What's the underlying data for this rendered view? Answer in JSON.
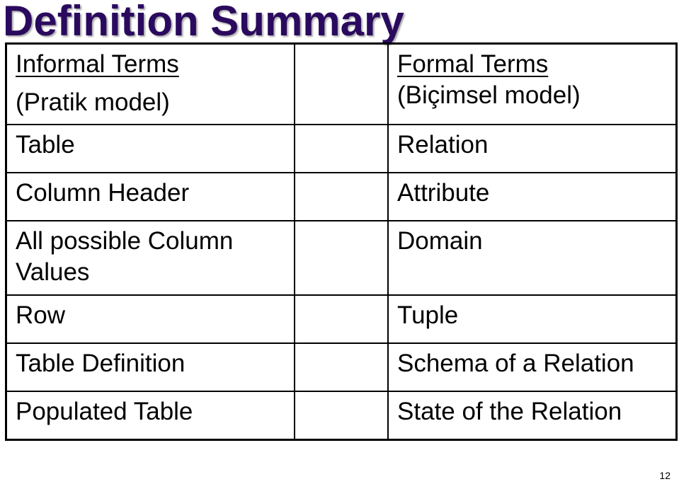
{
  "slide": {
    "title": "Definition Summary",
    "page_number": "12",
    "title_color": "#2a0a5e"
  },
  "table": {
    "header": {
      "informal_label": "Informal Terms",
      "informal_sub": "(Pratik model)",
      "middle": "",
      "formal_label": "Formal Terms",
      "formal_sub": "(Biçimsel model)"
    },
    "rows": [
      {
        "informal": "Table",
        "middle": "",
        "formal": "Relation"
      },
      {
        "informal": "Column Header",
        "middle": "",
        "formal": "Attribute"
      },
      {
        "informal": "All possible Column Values",
        "middle": "",
        "formal": "Domain"
      },
      {
        "informal": "Row",
        "middle": "",
        "formal": "Tuple"
      },
      {
        "informal": "Table Definition",
        "middle": "",
        "formal": "Schema of a Relation"
      },
      {
        "informal": "Populated Table",
        "middle": "",
        "formal": "State of the Relation"
      }
    ]
  }
}
